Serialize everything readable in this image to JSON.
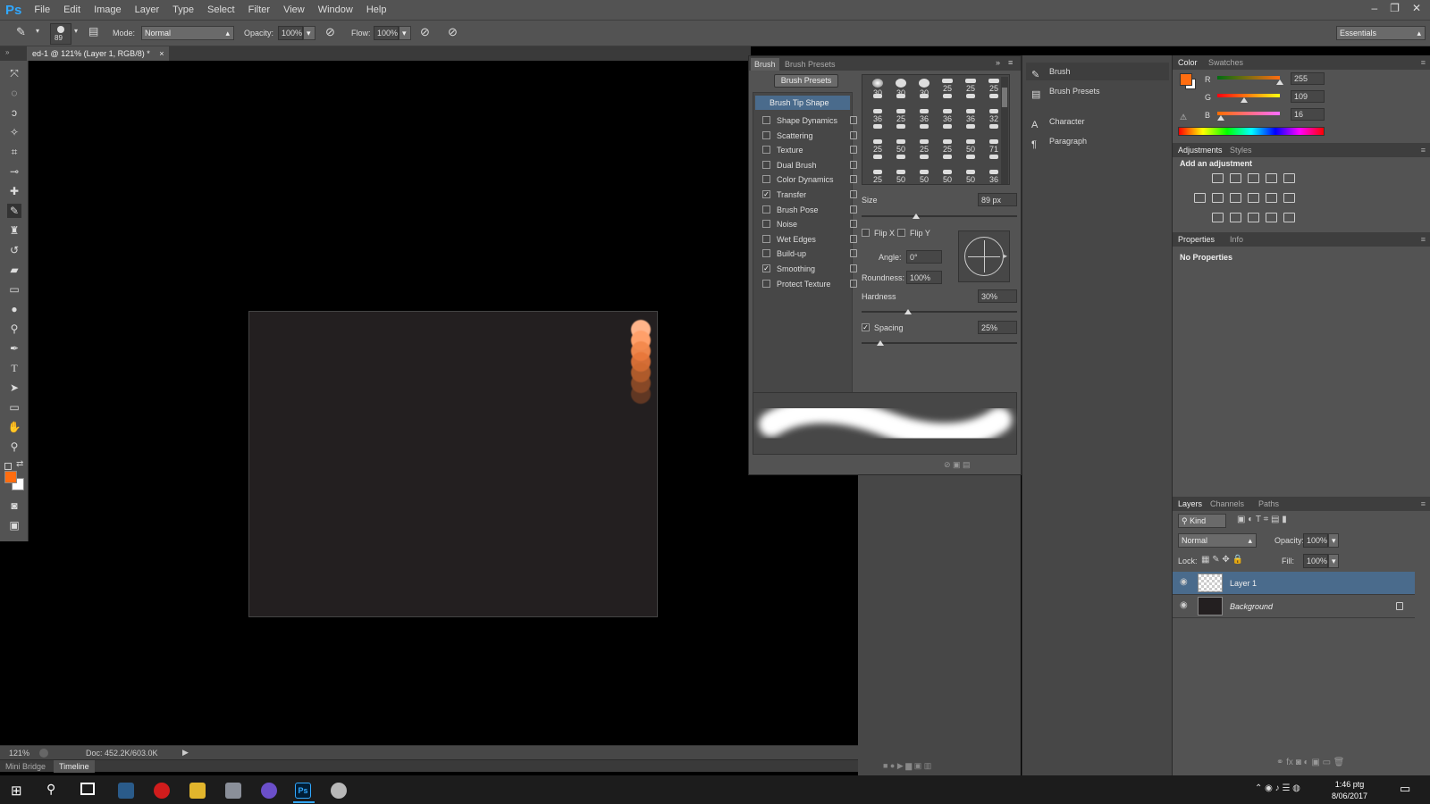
{
  "app": {
    "logo": "Ps",
    "workspace": "Essentials"
  },
  "menu": [
    "File",
    "Edit",
    "Image",
    "Layer",
    "Type",
    "Select",
    "Filter",
    "View",
    "Window",
    "Help"
  ],
  "window_controls": {
    "minimize": "–",
    "restore": "❐",
    "close": "✕"
  },
  "options_bar": {
    "brush_size": "89",
    "mode_label": "Mode:",
    "mode_value": "Normal",
    "opacity_label": "Opacity:",
    "opacity_value": "100%",
    "flow_label": "Flow:",
    "flow_value": "100%"
  },
  "document": {
    "tab_title": "ed-1 @ 121% (Layer 1, RGB/8) *",
    "close": "×"
  },
  "brush_strokes": [
    {
      "color": "#ffb48a",
      "opacity": 1
    },
    {
      "color": "#ffa06a",
      "opacity": 1
    },
    {
      "color": "#f48a4e",
      "opacity": 0.97
    },
    {
      "color": "#e8773a",
      "opacity": 0.9
    },
    {
      "color": "#d06a30",
      "opacity": 0.8
    },
    {
      "color": "#b05a2a",
      "opacity": 0.7
    },
    {
      "color": "#8a4826",
      "opacity": 0.6
    }
  ],
  "status": {
    "zoom": "121%",
    "doc": "Doc: 452.2K/603.0K"
  },
  "bottom_tabs": {
    "mini_bridge": "Mini Bridge",
    "timeline": "Timeline"
  },
  "brush_panel": {
    "tabs": [
      "Brush",
      "Brush Presets"
    ],
    "presets_button": "Brush Presets",
    "tip_shape": "Brush Tip Shape",
    "options": [
      {
        "label": "Shape Dynamics",
        "checked": false
      },
      {
        "label": "Scattering",
        "checked": false
      },
      {
        "label": "Texture",
        "checked": false
      },
      {
        "label": "Dual Brush",
        "checked": false
      },
      {
        "label": "Color Dynamics",
        "checked": false
      },
      {
        "label": "Transfer",
        "checked": true
      },
      {
        "label": "Brush Pose",
        "checked": false
      },
      {
        "label": "Noise",
        "checked": false
      },
      {
        "label": "Wet Edges",
        "checked": false
      },
      {
        "label": "Build-up",
        "checked": false
      },
      {
        "label": "Smoothing",
        "checked": true
      },
      {
        "label": "Protect Texture",
        "checked": false
      }
    ],
    "tip_sizes": [
      [
        "30",
        "30",
        "30",
        "25",
        "25",
        "25"
      ],
      [
        "",
        "",
        "",
        "",
        "",
        ""
      ],
      [
        "36",
        "25",
        "36",
        "36",
        "36",
        "32"
      ],
      [
        "",
        "",
        "",
        "",
        "",
        ""
      ],
      [
        "25",
        "50",
        "25",
        "25",
        "50",
        "71"
      ],
      [
        "",
        "",
        "",
        "",
        "",
        ""
      ],
      [
        "25",
        "50",
        "50",
        "50",
        "50",
        "36"
      ]
    ],
    "size_label": "Size",
    "size_value": "89 px",
    "size_level": 0.35,
    "flip_x": "Flip X",
    "flip_y": "Flip Y",
    "angle_label": "Angle:",
    "angle_value": "0°",
    "roundness_label": "Roundness:",
    "roundness_value": "100%",
    "hardness_label": "Hardness",
    "hardness_value": "30%",
    "hardness_level": 0.3,
    "spacing_label": "Spacing",
    "spacing_value": "25%",
    "spacing_level": 0.12
  },
  "mid_panel": [
    {
      "label": "Brush",
      "icon": "brush-icon",
      "active": true
    },
    {
      "label": "Brush Presets",
      "icon": "brush-presets-icon",
      "active": false
    },
    {
      "label": "Character",
      "icon": "character-icon",
      "active": false
    },
    {
      "label": "Paragraph",
      "icon": "paragraph-icon",
      "active": false
    }
  ],
  "color_panel": {
    "tabs": [
      "Color",
      "Swatches"
    ],
    "fg": "#ff6d10",
    "bg": "#ffffff",
    "channels": [
      {
        "label": "R",
        "value": "255",
        "level": 1.0
      },
      {
        "label": "G",
        "value": "109",
        "level": 0.43
      },
      {
        "label": "B",
        "value": "16",
        "level": 0.06
      }
    ]
  },
  "adjustments": {
    "tabs": [
      "Adjustments",
      "Styles"
    ],
    "heading": "Add an adjustment"
  },
  "properties": {
    "tabs": [
      "Properties",
      "Info"
    ],
    "text": "No Properties"
  },
  "layers": {
    "tabs": [
      "Layers",
      "Channels",
      "Paths"
    ],
    "kind": "Kind",
    "blend": "Normal",
    "opacity_label": "Opacity:",
    "opacity_value": "100%",
    "lock_label": "Lock:",
    "fill_label": "Fill:",
    "fill_value": "100%",
    "items": [
      {
        "name": "Layer 1",
        "selected": true
      },
      {
        "name": "Background",
        "selected": false
      }
    ]
  },
  "taskbar": {
    "time": "1:46 ptg",
    "date": "8/06/2017"
  }
}
